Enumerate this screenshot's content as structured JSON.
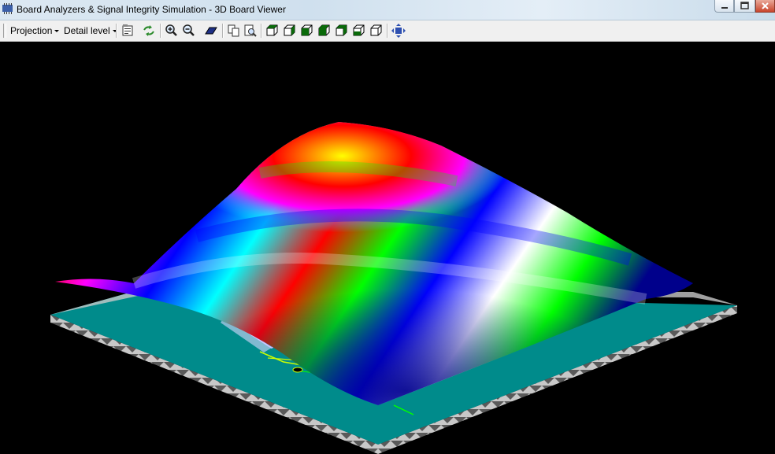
{
  "window": {
    "title": "Board Analyzers & Signal Integrity Simulation  - 3D Board Viewer",
    "controls": [
      "minimize",
      "maximize",
      "close"
    ]
  },
  "toolbar": {
    "projection_label": "Projection",
    "detail_label": "Detail level",
    "icons": [
      "properties-icon",
      "refresh-icon",
      "zoom-in-icon",
      "zoom-out-icon",
      "board-icon",
      "copy-icon",
      "print-preview-icon",
      "view-iso-1-icon",
      "view-iso-2-icon",
      "view-iso-3-icon",
      "view-iso-4-icon",
      "view-iso-5-icon",
      "view-iso-6-icon",
      "view-iso-7-icon",
      "fit-view-icon"
    ]
  },
  "viewer": {
    "background": "#000000",
    "board_color": "#008b8b",
    "board_edge_color": "#c8c8c8",
    "surface_palette": [
      "#ffff00",
      "#ff0000",
      "#ff00ff",
      "#0000ff",
      "#00ffff",
      "#00ff00",
      "#ffffff",
      "#8b8b00",
      "#00008b"
    ]
  }
}
